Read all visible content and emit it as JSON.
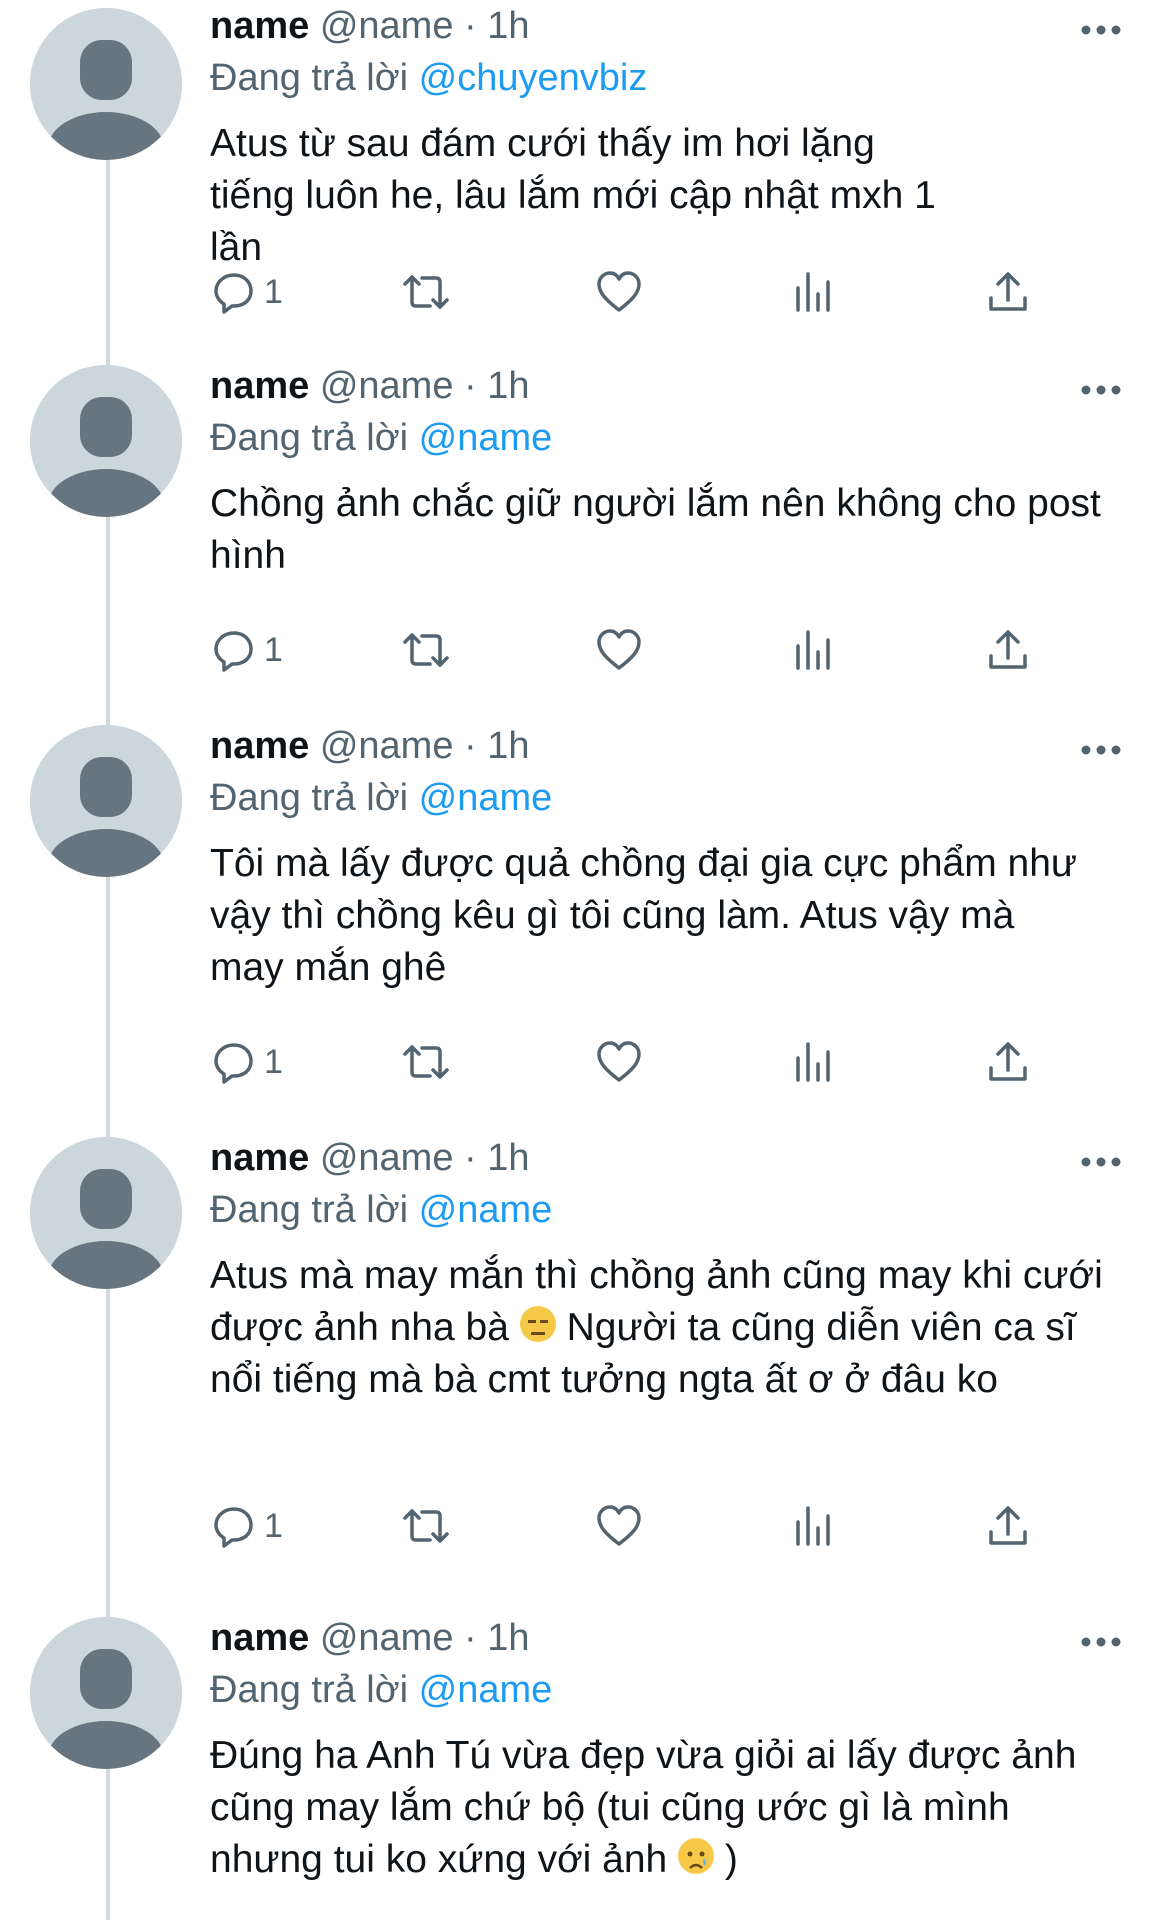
{
  "tweets": [
    {
      "name": "name",
      "handle": "@name",
      "time": "· 1h",
      "reply_prefix": "Đang trả lời",
      "reply_mention": "@chuyenvbiz",
      "text_1": "Atus từ sau đám cưới thấy im hơi lặng tiếng luôn he, lâu lắm mới cập nhật mxh 1 lần",
      "reply_count": "1"
    },
    {
      "name": "name",
      "handle": "@name",
      "time": "· 1h",
      "reply_prefix": "Đang trả lời",
      "reply_mention": "@name",
      "text_1": "Chồng ảnh chắc giữ người lắm nên không cho post hình",
      "reply_count": "1"
    },
    {
      "name": "name",
      "handle": "@name",
      "time": "· 1h",
      "reply_prefix": "Đang trả lời",
      "reply_mention": "@name",
      "text_1": "Tôi mà lấy được quả chồng đại gia cực phẩm như vậy thì chồng kêu gì tôi cũng làm. Atus vậy mà may mắn ghê",
      "reply_count": "1"
    },
    {
      "name": "name",
      "handle": "@name",
      "time": "· 1h",
      "reply_prefix": "Đang trả lời",
      "reply_mention": "@name",
      "text_1": "Atus mà may mắn thì chồng ảnh cũng may khi cưới được ảnh nha bà",
      "emoji": "expressionless-face-emoji",
      "text_2": "Người ta cũng diễn viên ca sĩ nổi tiếng mà bà cmt tưởng ngta ất ơ ở đâu ko",
      "reply_count": "1"
    },
    {
      "name": "name",
      "handle": "@name",
      "time": "· 1h",
      "reply_prefix": "Đang trả lời",
      "reply_mention": "@name",
      "text_1": "Đúng ha Anh Tú vừa đẹp vừa giỏi ai lấy được ảnh cũng may lắm chứ bộ (tui cũng ước gì là mình nhưng tui ko xứng với ảnh",
      "emoji": "crying-face-emoji",
      "text_2": ")"
    }
  ],
  "icons": {
    "reply": "reply-icon",
    "retweet": "retweet-icon",
    "like": "heart-icon",
    "views": "views-icon",
    "share": "share-icon",
    "more": "more-icon",
    "avatar": "default-avatar-icon"
  },
  "colors": {
    "text": "#0f1419",
    "secondary": "#536471",
    "mention": "#1d9bf0",
    "avatar_bg": "#ccd6dd",
    "avatar_fg": "#66757f",
    "thread_line": "#cfd9de"
  }
}
